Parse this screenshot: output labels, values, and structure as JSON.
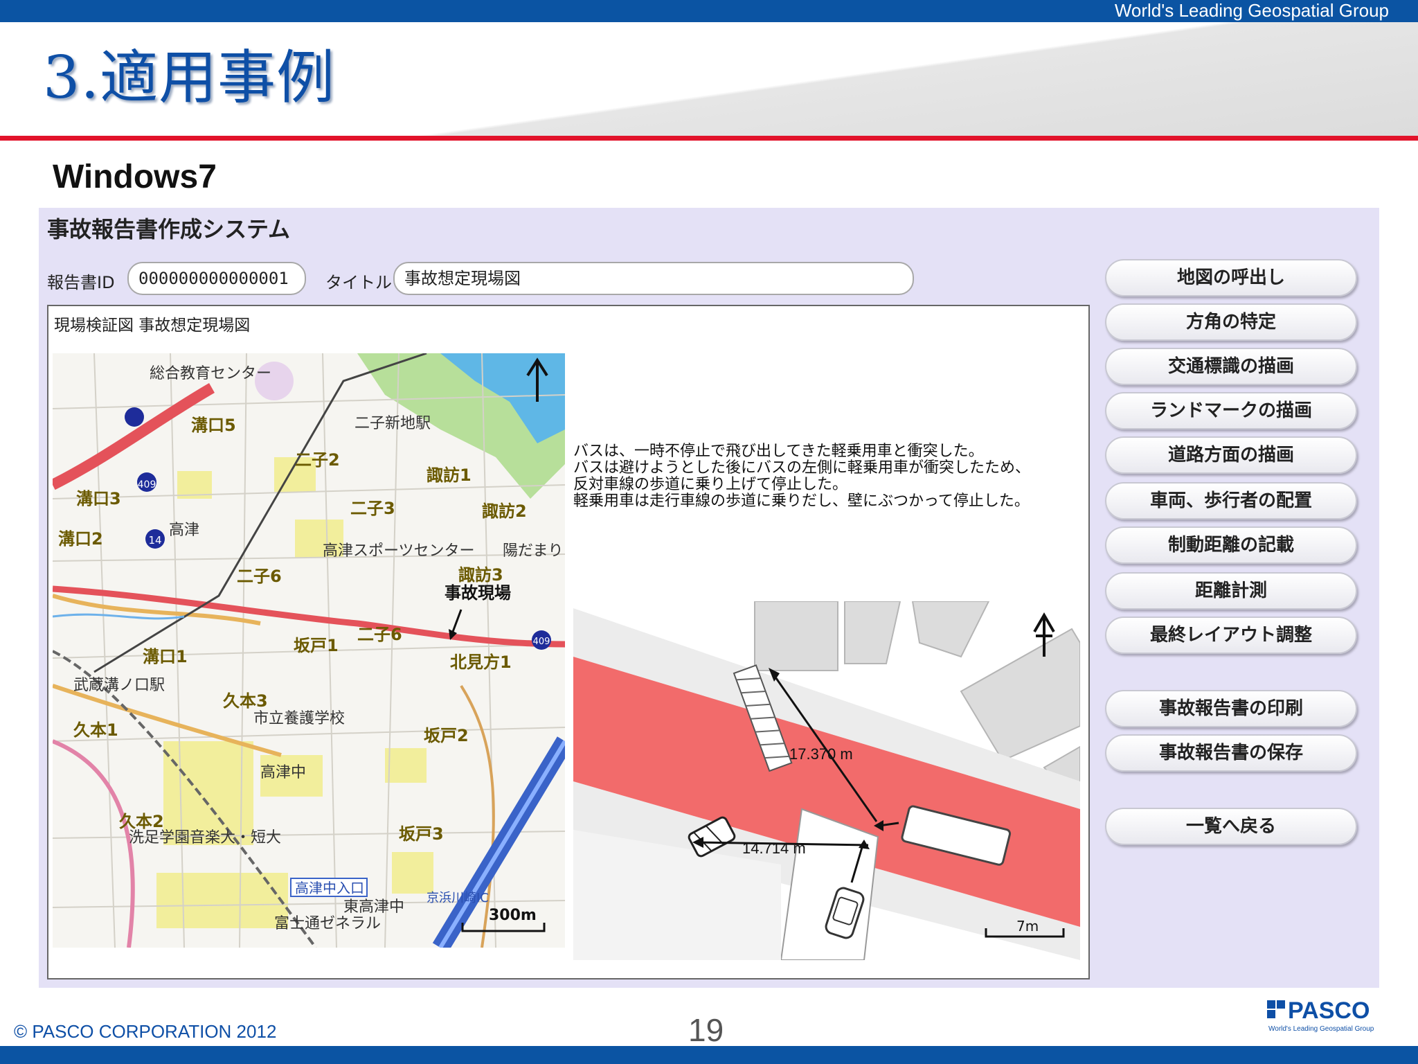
{
  "slide": {
    "tagline": "World's Leading Geospatial Group",
    "title": "3.適用事例",
    "subtitle": "Windows7",
    "copyright": "© PASCO CORPORATION 2012",
    "page_number": "19",
    "logo": {
      "name": "PASCO",
      "tagline": "World's Leading Geospatial Group"
    }
  },
  "app": {
    "window_title": "事故報告書作成システム",
    "report_id_label": "報告書ID",
    "report_id_value": "000000000000001",
    "title_label": "タイトル",
    "title_value": "事故想定現場図",
    "canvas_caption": "現場検証図 事故想定現場図",
    "accident_description": [
      "バスは、一時不停止で飛び出してきた軽乗用車と衝突した。",
      "バスは避けようとした後にバスの左側に軽乗用車が衝突したため、",
      "反対車線の歩道に乗り上げて停止した。",
      "軽乗用車は走行車線の歩道に乗りだし、壁にぶつかって停止した。"
    ],
    "diagram": {
      "measure_1": "17.370 m",
      "measure_2": "14.714 m",
      "scale_label": "7m"
    },
    "map": {
      "labels": [
        "総合教育センター",
        "二子新地駅",
        "溝口5",
        "二子2",
        "諏訪1",
        "溝口3",
        "二子3",
        "諏訪2",
        "溝口2",
        "高津",
        "高津スポーツセンター",
        "陽だまり",
        "二子6",
        "諏訪3",
        "事故現場",
        "坂戸1",
        "二子6",
        "北見方1",
        "溝口1",
        "武蔵溝ノ口駅",
        "久本3",
        "市立養護学校",
        "久本1",
        "坂戸2",
        "高津中",
        "久本2",
        "洗足学園音楽大・短大",
        "坂戸3",
        "高津中入口",
        "東高津中",
        "富士通ゼネラル",
        "京浜川崎IC",
        "300m"
      ],
      "routes": [
        "409",
        "14",
        "409"
      ]
    },
    "buttons": [
      "地図の呼出し",
      "方角の特定",
      "交通標識の描画",
      "ランドマークの描画",
      "道路方面の描画",
      "車両、歩行者の配置",
      "制動距離の記載",
      "距離計測",
      "最終レイアウト調整",
      "事故報告書の印刷",
      "事故報告書の保存",
      "一覧へ戻る"
    ]
  },
  "colors": {
    "header_blue": "#0b54a3",
    "accent_red": "#e2132b",
    "app_bg": "#e4e1f6",
    "road_red": "#f26b6b"
  }
}
